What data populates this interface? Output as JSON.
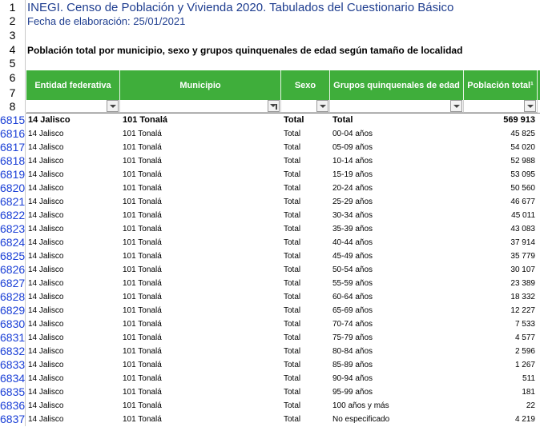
{
  "title": "INEGI. Censo de Población y Vivienda 2020. Tabulados del Cuestionario Básico",
  "subtitle": "Fecha de elaboración: 25/01/2021",
  "table_title": "Población total por municipio, sexo y grupos quinquenales de edad según tamaño de localidad",
  "row_numbers_top": [
    "1",
    "2",
    "3",
    "4",
    "5",
    "6",
    "7",
    "8"
  ],
  "headers": {
    "entidad": "Entidad federativa",
    "municipio": "Municipio",
    "sexo": "Sexo",
    "grupos": "Grupos quinquenales de edad",
    "poblacion": "Población total¹"
  },
  "rows": [
    {
      "n": "6815",
      "entidad": "14 Jalisco",
      "municipio": "101 Tonalá",
      "sexo": "Total",
      "grupo": "Total",
      "pob": "569 913"
    },
    {
      "n": "6816",
      "entidad": "14 Jalisco",
      "municipio": "101 Tonalá",
      "sexo": "Total",
      "grupo": "00-04 años",
      "pob": "45 825"
    },
    {
      "n": "6817",
      "entidad": "14 Jalisco",
      "municipio": "101 Tonalá",
      "sexo": "Total",
      "grupo": "05-09 años",
      "pob": "54 020"
    },
    {
      "n": "6818",
      "entidad": "14 Jalisco",
      "municipio": "101 Tonalá",
      "sexo": "Total",
      "grupo": "10-14 años",
      "pob": "52 988"
    },
    {
      "n": "6819",
      "entidad": "14 Jalisco",
      "municipio": "101 Tonalá",
      "sexo": "Total",
      "grupo": "15-19 años",
      "pob": "53 095"
    },
    {
      "n": "6820",
      "entidad": "14 Jalisco",
      "municipio": "101 Tonalá",
      "sexo": "Total",
      "grupo": "20-24 años",
      "pob": "50 560"
    },
    {
      "n": "6821",
      "entidad": "14 Jalisco",
      "municipio": "101 Tonalá",
      "sexo": "Total",
      "grupo": "25-29 años",
      "pob": "46 677"
    },
    {
      "n": "6822",
      "entidad": "14 Jalisco",
      "municipio": "101 Tonalá",
      "sexo": "Total",
      "grupo": "30-34 años",
      "pob": "45 011"
    },
    {
      "n": "6823",
      "entidad": "14 Jalisco",
      "municipio": "101 Tonalá",
      "sexo": "Total",
      "grupo": "35-39 años",
      "pob": "43 083"
    },
    {
      "n": "6824",
      "entidad": "14 Jalisco",
      "municipio": "101 Tonalá",
      "sexo": "Total",
      "grupo": "40-44 años",
      "pob": "37 914"
    },
    {
      "n": "6825",
      "entidad": "14 Jalisco",
      "municipio": "101 Tonalá",
      "sexo": "Total",
      "grupo": "45-49 años",
      "pob": "35 779"
    },
    {
      "n": "6826",
      "entidad": "14 Jalisco",
      "municipio": "101 Tonalá",
      "sexo": "Total",
      "grupo": "50-54 años",
      "pob": "30 107"
    },
    {
      "n": "6827",
      "entidad": "14 Jalisco",
      "municipio": "101 Tonalá",
      "sexo": "Total",
      "grupo": "55-59 años",
      "pob": "23 389"
    },
    {
      "n": "6828",
      "entidad": "14 Jalisco",
      "municipio": "101 Tonalá",
      "sexo": "Total",
      "grupo": "60-64 años",
      "pob": "18 332"
    },
    {
      "n": "6829",
      "entidad": "14 Jalisco",
      "municipio": "101 Tonalá",
      "sexo": "Total",
      "grupo": "65-69 años",
      "pob": "12 227"
    },
    {
      "n": "6830",
      "entidad": "14 Jalisco",
      "municipio": "101 Tonalá",
      "sexo": "Total",
      "grupo": "70-74 años",
      "pob": "7 533"
    },
    {
      "n": "6831",
      "entidad": "14 Jalisco",
      "municipio": "101 Tonalá",
      "sexo": "Total",
      "grupo": "75-79 años",
      "pob": "4 577"
    },
    {
      "n": "6832",
      "entidad": "14 Jalisco",
      "municipio": "101 Tonalá",
      "sexo": "Total",
      "grupo": "80-84 años",
      "pob": "2 596"
    },
    {
      "n": "6833",
      "entidad": "14 Jalisco",
      "municipio": "101 Tonalá",
      "sexo": "Total",
      "grupo": "85-89 años",
      "pob": "1 267"
    },
    {
      "n": "6834",
      "entidad": "14 Jalisco",
      "municipio": "101 Tonalá",
      "sexo": "Total",
      "grupo": "90-94 años",
      "pob": "511"
    },
    {
      "n": "6835",
      "entidad": "14 Jalisco",
      "municipio": "101 Tonalá",
      "sexo": "Total",
      "grupo": "95-99 años",
      "pob": "181"
    },
    {
      "n": "6836",
      "entidad": "14 Jalisco",
      "municipio": "101 Tonalá",
      "sexo": "Total",
      "grupo": "100 años y más",
      "pob": "22"
    },
    {
      "n": "6837",
      "entidad": "14 Jalisco",
      "municipio": "101 Tonalá",
      "sexo": "Total",
      "grupo": "No especificado",
      "pob": "4 219"
    }
  ],
  "colors": {
    "header_green": "#3fae3b",
    "title_blue": "#1e3d8f",
    "row_number_blue": "#1a3fd6"
  },
  "filter_active_column": "municipio"
}
